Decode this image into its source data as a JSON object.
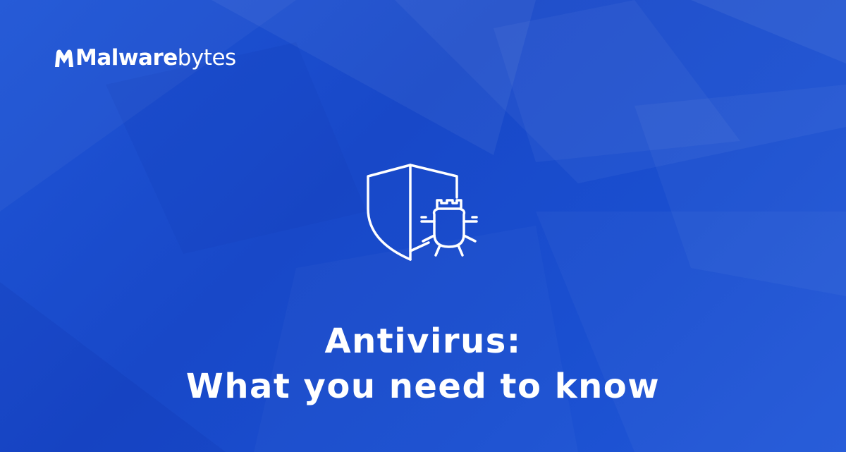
{
  "brand": {
    "name_part1": "Malware",
    "name_part2": "bytes",
    "logo_icon": "malwarebytes-m-icon"
  },
  "hero": {
    "icon": "shield-bug-icon"
  },
  "headline": {
    "line1": "Antivirus:",
    "line2": "What you need to know"
  },
  "colors": {
    "background": "#1a4fd0",
    "foreground": "#ffffff"
  }
}
